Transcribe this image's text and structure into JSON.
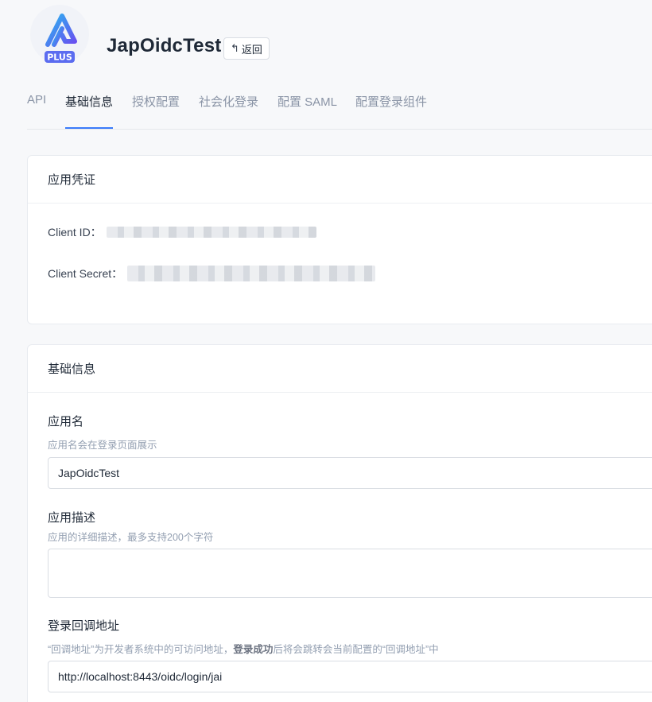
{
  "header": {
    "app_title": "JapOidcTest",
    "back_label": "返回",
    "logo_badge": "PLUS",
    "brand_color": "#5b6cf0"
  },
  "tabs": [
    {
      "label": "API",
      "active": false
    },
    {
      "label": "基础信息",
      "active": true
    },
    {
      "label": "授权配置",
      "active": false
    },
    {
      "label": "社会化登录",
      "active": false
    },
    {
      "label": "配置 SAML",
      "active": false
    },
    {
      "label": "配置登录组件",
      "active": false
    }
  ],
  "credentials": {
    "title": "应用凭证",
    "client_id_label": "Client ID：",
    "client_secret_label": "Client Secret："
  },
  "basic_info": {
    "title": "基础信息",
    "app_name": {
      "label": "应用名",
      "hint": "应用名会在登录页面展示",
      "value": "JapOidcTest"
    },
    "app_desc": {
      "label": "应用描述",
      "hint": "应用的详细描述，最多支持200个字符",
      "value": ""
    },
    "callback": {
      "label": "登录回调地址",
      "hint_pre": "“回调地址”为开发者系统中的可访问地址，",
      "hint_bold": "登录成功",
      "hint_post": "后将会跳转会当前配置的“回调地址”中",
      "value": "http://localhost:8443/oidc/login/jai"
    }
  },
  "colors": {
    "accent": "#3a7bfa",
    "muted_text": "#8a94a6"
  }
}
